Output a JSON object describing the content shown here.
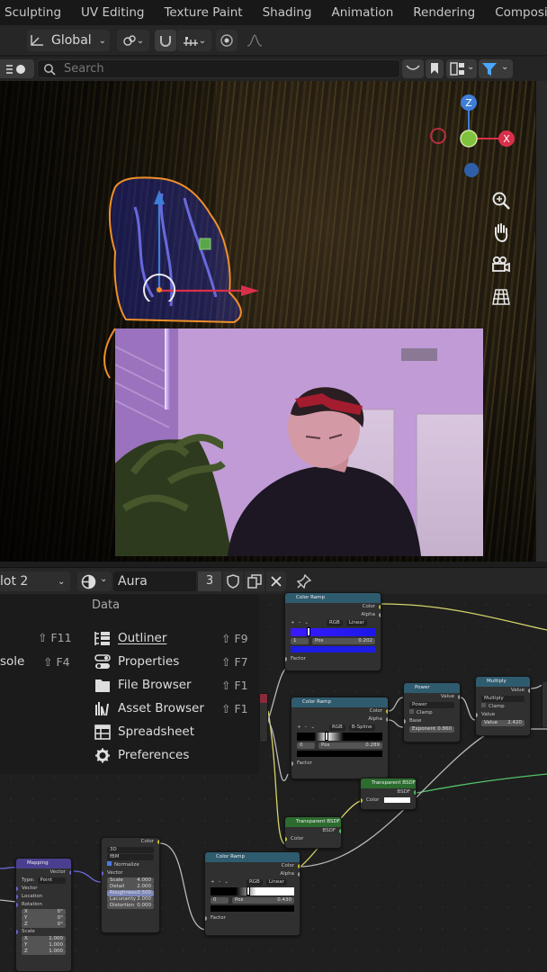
{
  "workspace_tabs": [
    "Sculpting",
    "UV Editing",
    "Texture Paint",
    "Shading",
    "Animation",
    "Rendering",
    "Compositing"
  ],
  "viewport_header": {
    "orientation": "Global"
  },
  "search": {
    "placeholder": "Search"
  },
  "gizmo": {
    "z_label": "Z",
    "x_label": "X"
  },
  "node_header": {
    "slot": "lot 2",
    "material_name": "Aura",
    "user_count": "3"
  },
  "window_menu": {
    "section_title": "Data",
    "left_items": [
      {
        "label": "",
        "shortcut": "⇧ F11"
      },
      {
        "label": "sole",
        "shortcut": "⇧ F4"
      }
    ],
    "items": [
      {
        "label": "Outliner",
        "shortcut": "⇧ F9"
      },
      {
        "label": "Properties",
        "shortcut": "⇧ F7"
      },
      {
        "label": "File Browser",
        "shortcut": "⇧ F1"
      },
      {
        "label": "Asset Browser",
        "shortcut": "⇧ F1"
      },
      {
        "label": "Spreadsheet",
        "shortcut": ""
      },
      {
        "label": "Preferences",
        "shortcut": ""
      }
    ]
  },
  "nodes": {
    "ramp1": {
      "title": "Color Ramp",
      "out1": "Color",
      "out2": "Alpha",
      "mode": "RGB",
      "interp": "Linear",
      "index": "1",
      "pos_label": "Pos",
      "pos": "0.202",
      "in": "Factor"
    },
    "ramp2": {
      "title": "Color Ramp",
      "out1": "Color",
      "out2": "Alpha",
      "mode": "RGB",
      "interp": "B-Spline",
      "index": "0",
      "pos_label": "Pos",
      "pos": "0.289",
      "in": "Factor"
    },
    "ramp3": {
      "title": "Color Ramp",
      "out1": "Color",
      "out2": "Alpha",
      "mode": "RGB",
      "interp": "Linear",
      "index": "0",
      "pos_label": "Pos",
      "pos": "0.430",
      "in": "Factor"
    },
    "power": {
      "title": "Power",
      "out": "Value",
      "op": "Power",
      "clamp": "Clamp",
      "in1": "Base",
      "exp_label": "Exponent",
      "exp": "0.860"
    },
    "multiply": {
      "title": "Multiply",
      "out": "Value",
      "op": "Multiply",
      "clamp": "Clamp",
      "in1": "Value",
      "val_label": "Value",
      "val": "2.420"
    },
    "transp1": {
      "title": "Transparent BSDF",
      "out": "BSDF",
      "in": "Color"
    },
    "transp2": {
      "title": "Transparent BSDF",
      "out": "BSDF",
      "in": "Color"
    },
    "mapping": {
      "title": "Mapping",
      "out": "Vector",
      "type_label": "Type:",
      "type": "Point",
      "in_vector": "Vector",
      "location": "Location",
      "rotation": "Rotation",
      "x": "X",
      "y": "Y",
      "z": "Z",
      "rot_val": "0°",
      "scale": "Scale",
      "scale_val": "1.000"
    },
    "noise": {
      "out": "Color",
      "dim": "3D",
      "kind": "fBM",
      "normalize": "Normalize",
      "in_vector": "Vector",
      "params": [
        {
          "k": "Scale",
          "v": "4.000"
        },
        {
          "k": "Detail",
          "v": "2.000"
        },
        {
          "k": "Roughness",
          "v": "0.500"
        },
        {
          "k": "Lacunarity",
          "v": "2.000"
        },
        {
          "k": "Distortion",
          "v": "0.000"
        }
      ]
    }
  }
}
